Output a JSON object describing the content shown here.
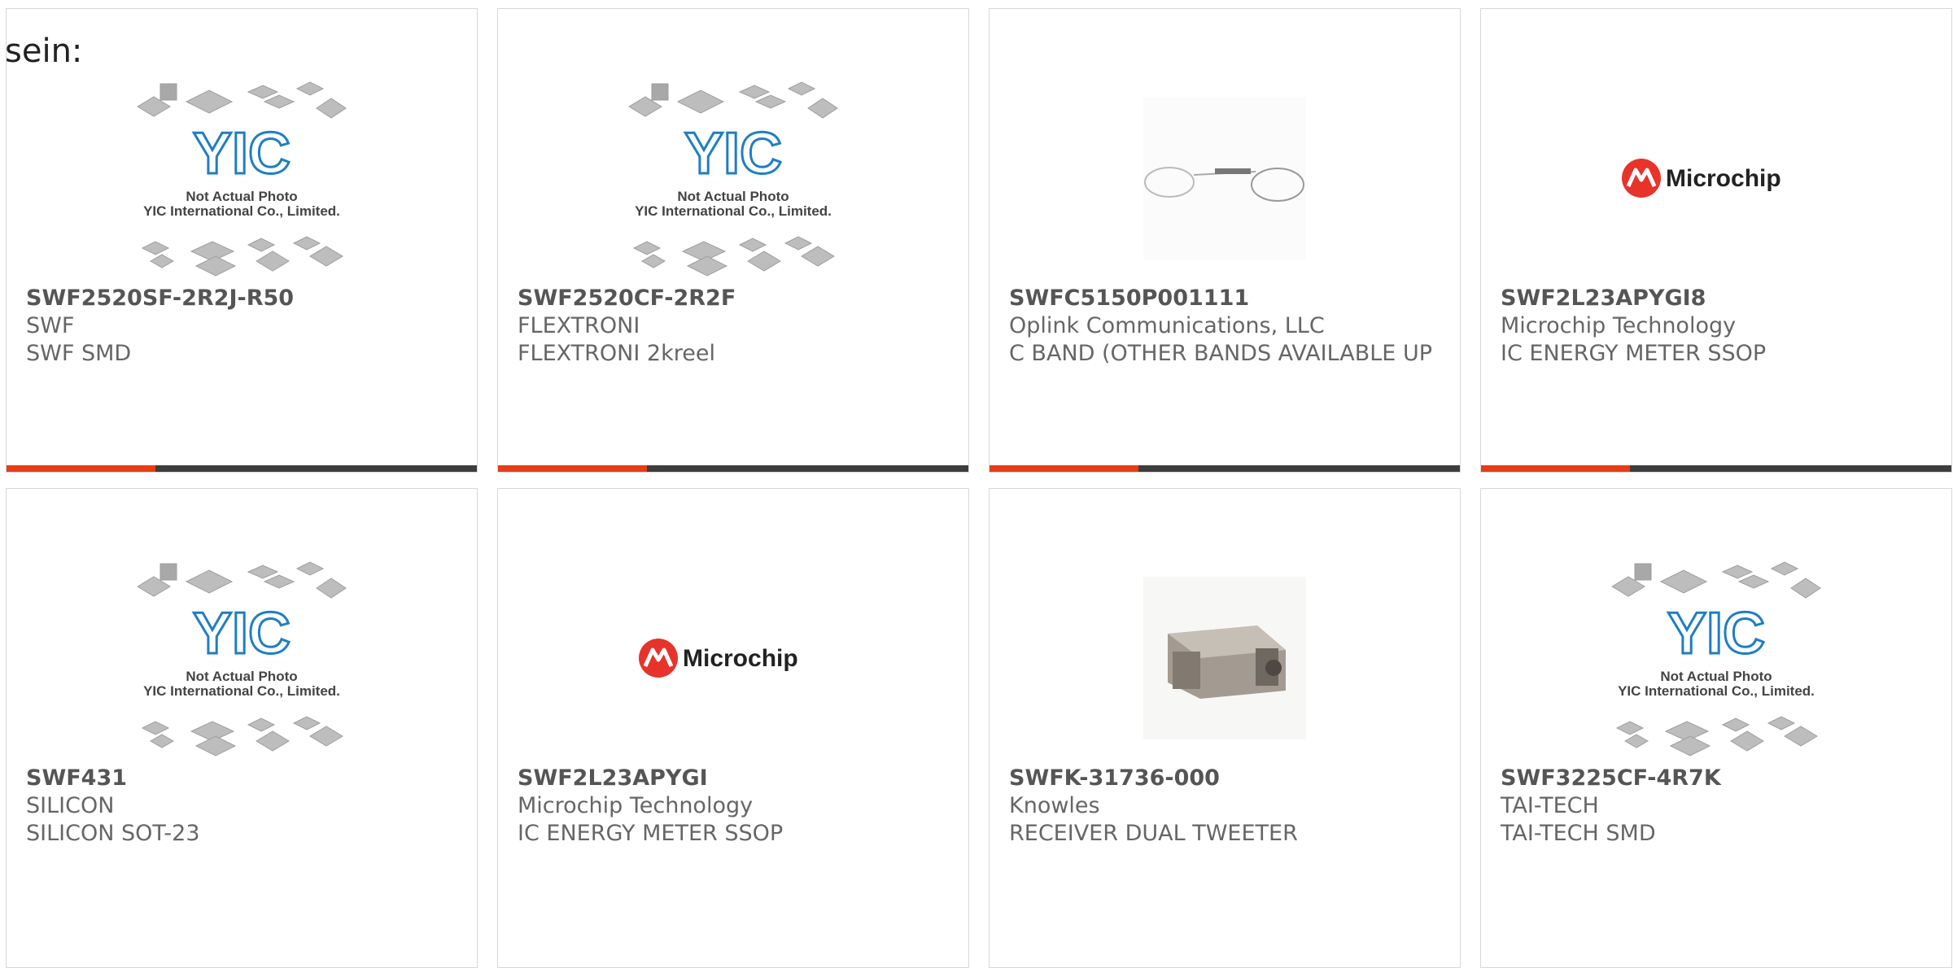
{
  "lead_text": "sein:",
  "placeholder": {
    "brand": "YIC",
    "line1": "Not Actual Photo",
    "line2": "YIC International Co., Limited."
  },
  "microchip_logo_text": "Microchip",
  "colors": {
    "accent": "#e83c14",
    "bar": "#3d3d3d",
    "border": "#d8d8d8",
    "yic_blue": "#1f7ec2"
  },
  "products": [
    {
      "part": "SWF2520SF-2R2J-R50",
      "maker": "SWF",
      "desc": "SWF SMD",
      "image": "yic-placeholder",
      "bar": true
    },
    {
      "part": "SWF2520CF-2R2F",
      "maker": "FLEXTRONI",
      "desc": "FLEXTRONI 2kreel",
      "image": "yic-placeholder",
      "bar": true
    },
    {
      "part": "SWFC5150P001111",
      "maker": "Oplink Communications, LLC",
      "desc": "C BAND (OTHER BANDS AVAILABLE UP",
      "image": "fiber-coupler-photo",
      "bar": true
    },
    {
      "part": "SWF2L23APYGI8",
      "maker": "Microchip Technology",
      "desc": "IC ENERGY METER SSOP",
      "image": "microchip-logo",
      "bar": true
    },
    {
      "part": "SWF431",
      "maker": "SILICON",
      "desc": "SILICON SOT-23",
      "image": "yic-placeholder",
      "bar": false
    },
    {
      "part": "SWF2L23APYGI",
      "maker": "Microchip Technology",
      "desc": "IC ENERGY METER SSOP",
      "image": "microchip-logo",
      "bar": false
    },
    {
      "part": "SWFK-31736-000",
      "maker": "Knowles",
      "desc": "RECEIVER DUAL TWEETER",
      "image": "receiver-photo",
      "bar": false
    },
    {
      "part": "SWF3225CF-4R7K",
      "maker": "TAI-TECH",
      "desc": "TAI-TECH SMD",
      "image": "yic-placeholder",
      "bar": false
    }
  ]
}
